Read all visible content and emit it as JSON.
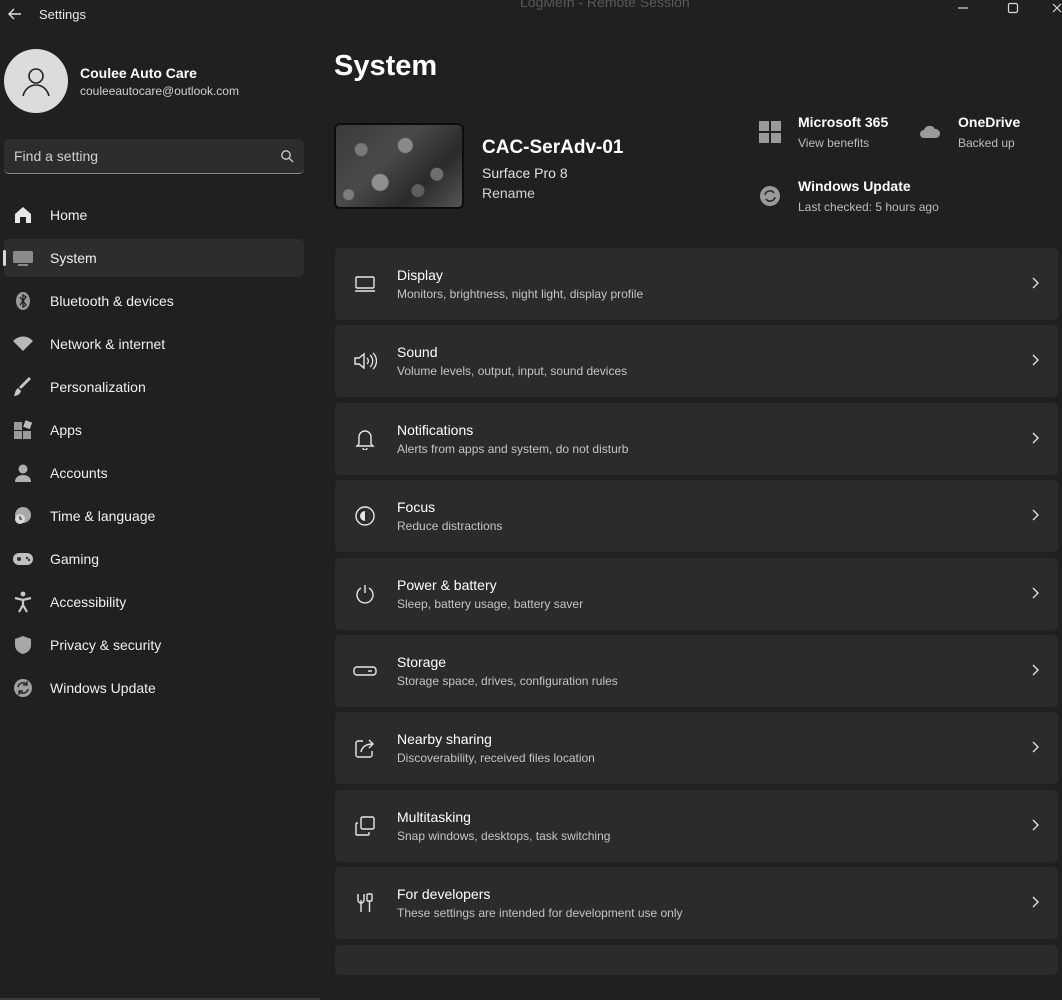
{
  "window": {
    "title": "Settings",
    "remote_title": "LogMeIn - Remote Session"
  },
  "user": {
    "name": "Coulee Auto Care",
    "email": "couleeautocare@outlook.com"
  },
  "search": {
    "placeholder": "Find a setting"
  },
  "sidebar": {
    "items": [
      {
        "label": "Home",
        "icon": "home-icon"
      },
      {
        "label": "System",
        "icon": "system-icon",
        "active": true
      },
      {
        "label": "Bluetooth & devices",
        "icon": "bluetooth-icon"
      },
      {
        "label": "Network & internet",
        "icon": "wifi-icon"
      },
      {
        "label": "Personalization",
        "icon": "brush-icon"
      },
      {
        "label": "Apps",
        "icon": "apps-icon"
      },
      {
        "label": "Accounts",
        "icon": "person-icon"
      },
      {
        "label": "Time & language",
        "icon": "globe-clock-icon"
      },
      {
        "label": "Gaming",
        "icon": "gamepad-icon"
      },
      {
        "label": "Accessibility",
        "icon": "accessibility-icon"
      },
      {
        "label": "Privacy & security",
        "icon": "shield-icon"
      },
      {
        "label": "Windows Update",
        "icon": "update-icon"
      }
    ]
  },
  "main": {
    "title": "System",
    "device": {
      "name": "CAC-SerAdv-01",
      "model": "Surface Pro 8",
      "rename": "Rename"
    },
    "tiles": {
      "microsoft365": {
        "title": "Microsoft 365",
        "sub": "View benefits"
      },
      "onedrive": {
        "title": "OneDrive",
        "sub": "Backed up"
      },
      "windows_update": {
        "title": "Windows Update",
        "sub": "Last checked: 5 hours ago"
      }
    },
    "cards": [
      {
        "title": "Display",
        "sub": "Monitors, brightness, night light, display profile",
        "icon": "monitor-icon"
      },
      {
        "title": "Sound",
        "sub": "Volume levels, output, input, sound devices",
        "icon": "speaker-icon"
      },
      {
        "title": "Notifications",
        "sub": "Alerts from apps and system, do not disturb",
        "icon": "bell-icon"
      },
      {
        "title": "Focus",
        "sub": "Reduce distractions",
        "icon": "focus-icon"
      },
      {
        "title": "Power & battery",
        "sub": "Sleep, battery usage, battery saver",
        "icon": "power-icon"
      },
      {
        "title": "Storage",
        "sub": "Storage space, drives, configuration rules",
        "icon": "storage-icon"
      },
      {
        "title": "Nearby sharing",
        "sub": "Discoverability, received files location",
        "icon": "share-icon"
      },
      {
        "title": "Multitasking",
        "sub": "Snap windows, desktops, task switching",
        "icon": "multitask-icon"
      },
      {
        "title": "For developers",
        "sub": "These settings are intended for development use only",
        "icon": "developer-tools-icon"
      }
    ]
  }
}
